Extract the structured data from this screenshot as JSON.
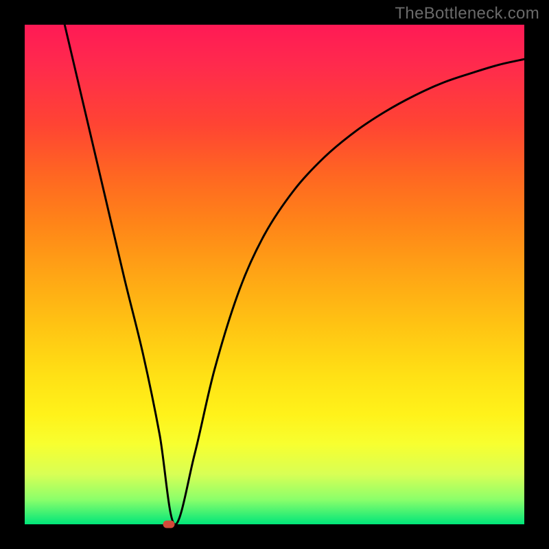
{
  "watermark": "TheBottleneck.com",
  "chart_data": {
    "type": "line",
    "title": "",
    "xlabel": "",
    "ylabel": "",
    "xlim": [
      0,
      100
    ],
    "ylim": [
      0,
      100
    ],
    "grid": false,
    "series": [
      {
        "name": "curve",
        "x": [
          8.0,
          12,
          16,
          20,
          23.7,
          27,
          30,
          34,
          38,
          43,
          48,
          54,
          60,
          66,
          72,
          78,
          84,
          90,
          95,
          100
        ],
        "values": [
          100,
          83,
          66,
          49,
          34,
          18,
          0,
          14,
          31,
          47,
          58,
          67,
          73.5,
          78.5,
          82.5,
          85.8,
          88.5,
          90.5,
          92,
          93.1
        ]
      }
    ],
    "marker": {
      "x": 28.8,
      "y": 0
    },
    "background": {
      "gradient": "vertical",
      "stops": [
        {
          "pos": 0.0,
          "color": "#ff1a55"
        },
        {
          "pos": 0.5,
          "color": "#ffa515"
        },
        {
          "pos": 0.8,
          "color": "#fff21a"
        },
        {
          "pos": 1.0,
          "color": "#00e67a"
        }
      ]
    },
    "curve_stroke": "#000000",
    "curve_width": 3
  }
}
